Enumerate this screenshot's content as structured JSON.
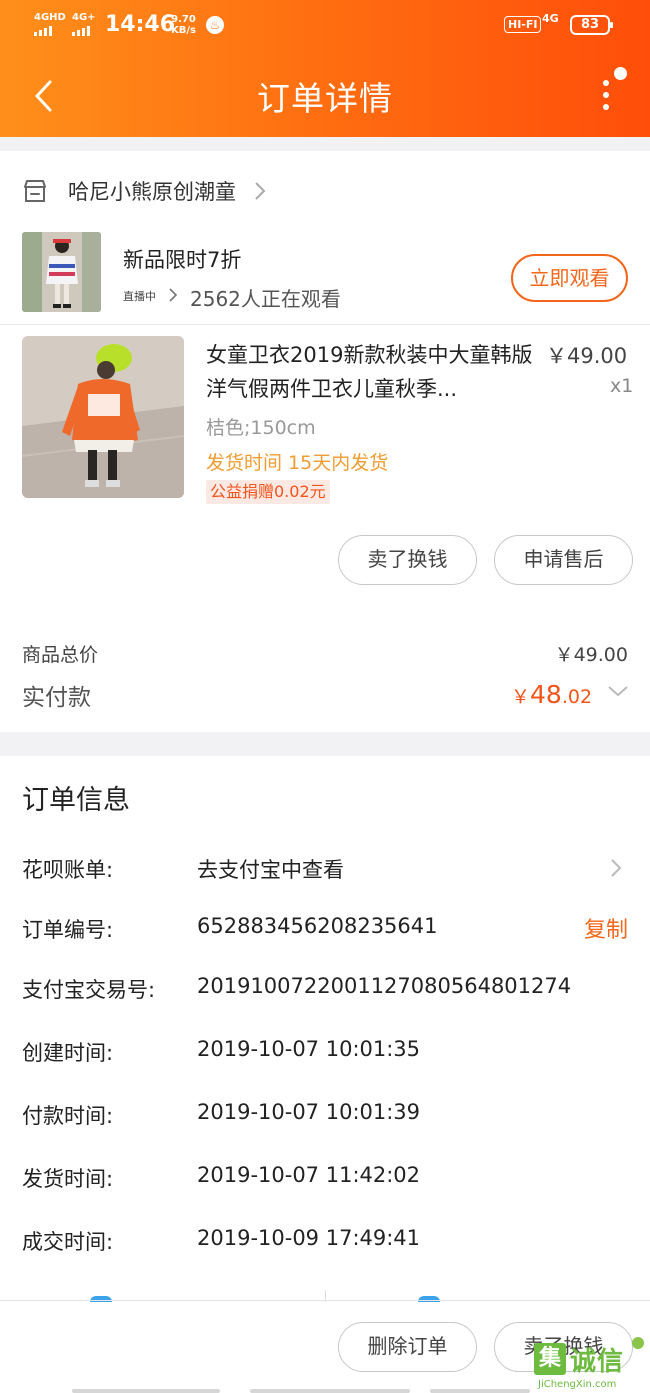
{
  "status_bar": {
    "signal1": "4GHD",
    "signal2": "4G+",
    "time": "14:46",
    "speed_value": "9.70",
    "speed_unit": "KB/s",
    "hifi": "HI-FI",
    "network": "4G",
    "battery": "83"
  },
  "nav": {
    "title": "订单详情"
  },
  "shop": {
    "name": "哈尼小熊原创潮童"
  },
  "live": {
    "title": "新品限时7折",
    "tag": "直播中",
    "viewers": "2562人正在观看",
    "watch_button": "立即观看"
  },
  "product": {
    "title": "女童卫衣2019新款秋装中大童韩版洋气假两件卫衣儿童秋季...",
    "price": "￥49.00",
    "quantity": "x1",
    "sku": "桔色;150cm",
    "shipping": "发货时间 15天内发货",
    "charity": "公益捐赠0.02元",
    "actions": [
      "卖了换钱",
      "申请售后"
    ]
  },
  "summary": {
    "total_label": "商品总价",
    "total_value": "￥49.00",
    "paid_label": "实付款",
    "paid_currency": "￥",
    "paid_integer": "48",
    "paid_decimal": ".02"
  },
  "order_info": {
    "title": "订单信息",
    "rows": [
      {
        "label": "花呗账单:",
        "value": "去支付宝中查看"
      },
      {
        "label": "订单编号:",
        "value": "652883456208235641",
        "action": "复制"
      },
      {
        "label": "支付宝交易号:",
        "value": "2019100722001127080564801274"
      },
      {
        "label": "创建时间:",
        "value": "2019-10-07 10:01:35"
      },
      {
        "label": "付款时间:",
        "value": "2019-10-07 10:01:39"
      },
      {
        "label": "发货时间:",
        "value": "2019-10-07 11:42:02"
      },
      {
        "label": "成交时间:",
        "value": "2019-10-09 17:49:41"
      }
    ]
  },
  "bottom_bar": {
    "delete_order": "删除订单",
    "sell": "卖了换钱"
  },
  "watermark": {
    "box": "集",
    "cn": "诚信",
    "en": "JiChengXin.com"
  },
  "colors": {
    "accent": "#f2671b",
    "header_start": "#ff8f1a",
    "header_end": "#ff4e0a",
    "price_red": "#f2541b",
    "ship_orange": "#ef9d32"
  }
}
